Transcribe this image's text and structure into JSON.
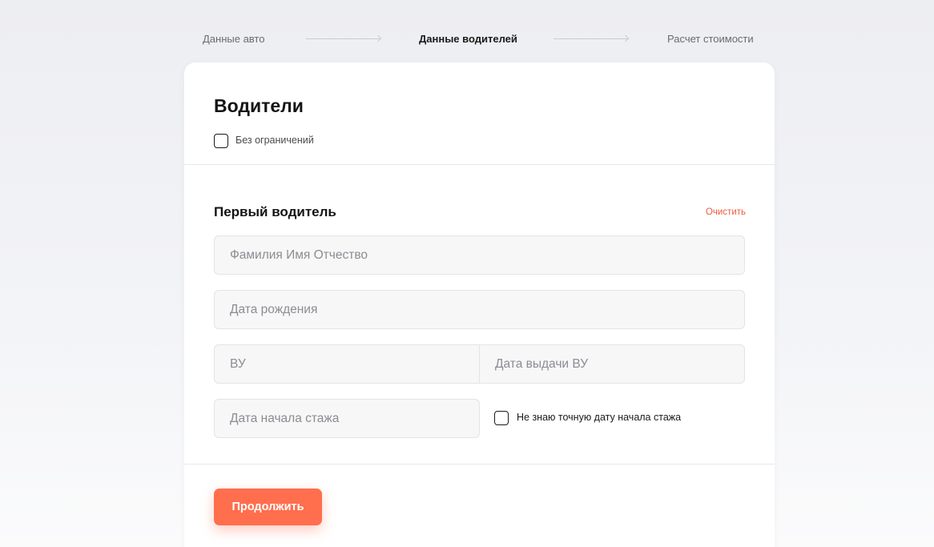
{
  "stepper": {
    "steps": [
      {
        "label": "Данные авто",
        "active": false
      },
      {
        "label": "Данные водителей",
        "active": true
      },
      {
        "label": "Расчет стоимости",
        "active": false
      }
    ]
  },
  "card": {
    "title": "Водители",
    "unlimited_label": "Без ограничений",
    "unlimited_checked": false
  },
  "driver": {
    "title": "Первый водитель",
    "clear_label": "Очистить",
    "fields": {
      "full_name": {
        "placeholder": "Фамилия Имя Отчество",
        "value": ""
      },
      "birth_date": {
        "placeholder": "Дата рождения",
        "value": ""
      },
      "license": {
        "placeholder": "ВУ",
        "value": ""
      },
      "license_date": {
        "placeholder": "Дата выдачи ВУ",
        "value": ""
      },
      "experience_start": {
        "placeholder": "Дата начала стажа",
        "value": ""
      }
    },
    "unknown_experience_label": "Не знаю точную дату начала стажа",
    "unknown_experience_checked": false
  },
  "actions": {
    "continue_label": "Продолжить"
  },
  "colors": {
    "accent": "#ff6e4d",
    "link": "#f05a3c",
    "field_bg": "#f7f7f8"
  }
}
